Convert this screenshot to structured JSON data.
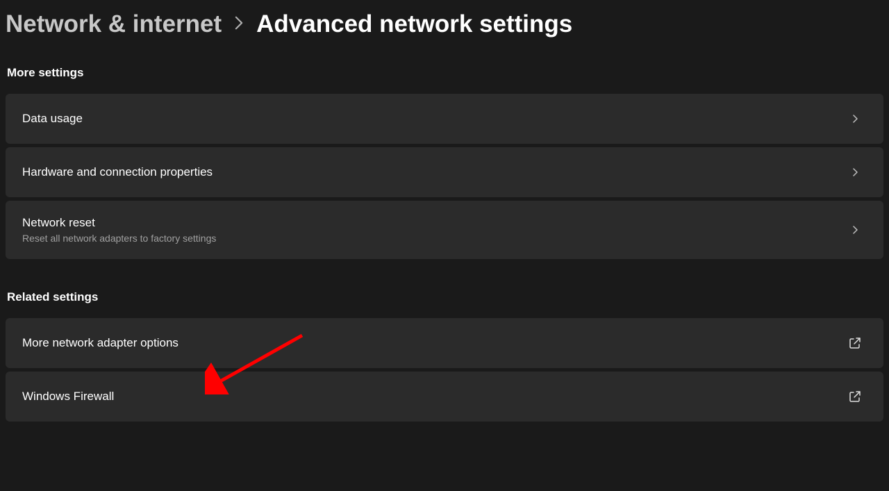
{
  "breadcrumb": {
    "parent": "Network & internet",
    "current": "Advanced network settings"
  },
  "sections": {
    "more_settings": {
      "heading": "More settings",
      "items": [
        {
          "title": "Data usage",
          "subtitle": "",
          "icon": "chevron"
        },
        {
          "title": "Hardware and connection properties",
          "subtitle": "",
          "icon": "chevron"
        },
        {
          "title": "Network reset",
          "subtitle": "Reset all network adapters to factory settings",
          "icon": "chevron"
        }
      ]
    },
    "related_settings": {
      "heading": "Related settings",
      "items": [
        {
          "title": "More network adapter options",
          "subtitle": "",
          "icon": "external"
        },
        {
          "title": "Windows Firewall",
          "subtitle": "",
          "icon": "external"
        }
      ]
    }
  }
}
